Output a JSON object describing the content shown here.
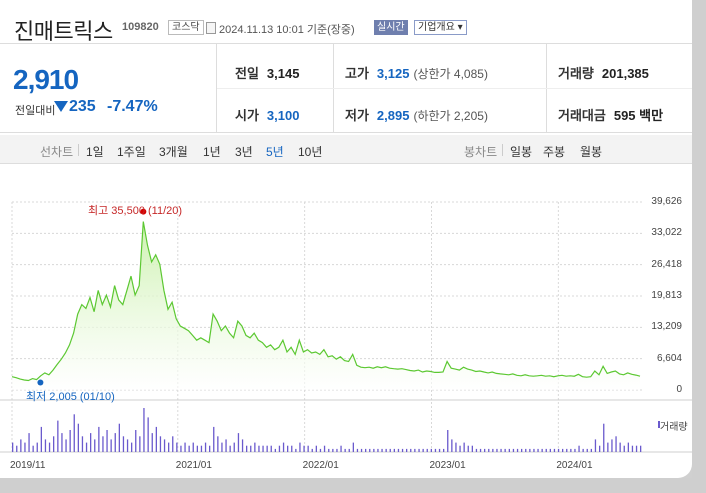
{
  "header": {
    "name": "진매트릭스",
    "code": "109820",
    "market": "코스닥",
    "timestamp": "2024.11.13 10:01",
    "basis": "기준(장중)",
    "live_label": "실시간",
    "company_info_label": "기업개요 ▾"
  },
  "quote": {
    "price": "2,910",
    "change_label": "전일대비",
    "change": "235",
    "change_pct": "-7.47%",
    "direction": "down",
    "color": "#1565c0"
  },
  "stats": {
    "prev_close": {
      "label": "전일",
      "value": "3,145"
    },
    "high": {
      "label": "고가",
      "value": "3,125",
      "note": "(상한가 4,085)"
    },
    "volume": {
      "label": "거래량",
      "value": "201,385"
    },
    "open": {
      "label": "시가",
      "value": "3,100"
    },
    "low": {
      "label": "저가",
      "value": "2,895",
      "note": "(하한가 2,205)"
    },
    "turnover": {
      "label": "거래대금",
      "value": "595 백만"
    }
  },
  "period_bar": {
    "line_label": "선차트",
    "periods": [
      "1일",
      "1주일",
      "3개월",
      "1년",
      "3년",
      "5년",
      "10년"
    ],
    "selected": "5년",
    "candle_label": "봉차트",
    "candles": [
      "일봉",
      "주봉",
      "월봉"
    ]
  },
  "chart_data": {
    "type": "area",
    "title": "",
    "y_ticks": [
      "39,626",
      "33,022",
      "26,418",
      "19,813",
      "13,209",
      "6,604",
      "0"
    ],
    "ylim": [
      0,
      39626
    ],
    "x_ticks": [
      "2019/11",
      "2021/01",
      "2022/01",
      "2023/01",
      "2024/01"
    ],
    "x_start": "2019-11",
    "x_end": "2024-11",
    "series": [
      {
        "values": [
          2800,
          2600,
          2300,
          2100,
          2005,
          2400,
          2200,
          3000,
          3600,
          3200,
          4200,
          5400,
          6500,
          7800,
          9500,
          12000,
          16000,
          18000,
          17200,
          19500,
          16500,
          21000,
          18000,
          20000,
          17500,
          22000,
          19000,
          18000,
          21000,
          24000,
          20000,
          22000,
          35500,
          30500,
          27000,
          28500,
          26500,
          21000,
          17000,
          18500,
          15000,
          13500,
          13000,
          12500,
          11500,
          10500,
          11000,
          10500,
          10000,
          16000,
          14500,
          12500,
          13500,
          12000,
          11000,
          14500,
          13500,
          11500,
          11000,
          12000,
          10500,
          10000,
          9000,
          9500,
          8500,
          9000,
          10500,
          8000,
          9000,
          7500,
          10500,
          8000,
          8500,
          7800,
          8000,
          7500,
          8500,
          7000,
          7200,
          6500,
          7000,
          6200,
          6000,
          7500,
          5200,
          4800,
          4700,
          4800,
          4600,
          4900,
          4700,
          4900,
          4600,
          4500,
          4400,
          4500,
          4300,
          4100,
          4000,
          4200,
          3800,
          4000,
          3900,
          3700,
          3700,
          3800,
          6000,
          4600,
          4400,
          4200,
          4800,
          4400,
          4200,
          3900,
          4000,
          3800,
          3600,
          3800,
          3500,
          3400,
          3300,
          3200,
          3400,
          3100,
          3000,
          3200,
          3000,
          2900,
          3000,
          3100,
          2900,
          3000,
          2800,
          3000,
          3100,
          2900,
          3000,
          2900,
          3300,
          2800,
          2700,
          2800,
          4000,
          3200,
          5000,
          3500,
          3800,
          4000,
          3400,
          3200,
          3600,
          3300,
          3145,
          2910
        ]
      }
    ],
    "annotations": [
      {
        "text": "최고 35,500 (11/20)",
        "type": "max",
        "value": 35500
      },
      {
        "text": "최저 2,005 (01/10)",
        "type": "min",
        "value": 2005
      }
    ],
    "volume_label": "거래량",
    "volume": [
      3,
      2,
      4,
      3,
      6,
      2,
      3,
      8,
      4,
      3,
      5,
      10,
      6,
      4,
      7,
      12,
      9,
      5,
      3,
      6,
      4,
      8,
      5,
      7,
      4,
      6,
      9,
      5,
      4,
      3,
      7,
      5,
      14,
      11,
      6,
      8,
      5,
      4,
      3,
      5,
      3,
      2,
      3,
      2,
      3,
      2,
      2,
      3,
      2,
      8,
      5,
      3,
      4,
      2,
      3,
      6,
      4,
      2,
      2,
      3,
      2,
      2,
      2,
      2,
      1,
      2,
      3,
      2,
      2,
      1,
      3,
      2,
      2,
      1,
      2,
      1,
      2,
      1,
      1,
      1,
      2,
      1,
      1,
      3,
      1,
      1,
      1,
      1,
      1,
      1,
      1,
      1,
      1,
      1,
      1,
      1,
      1,
      1,
      1,
      1,
      1,
      1,
      1,
      1,
      1,
      1,
      7,
      4,
      3,
      2,
      3,
      2,
      2,
      1,
      1,
      1,
      1,
      1,
      1,
      1,
      1,
      1,
      1,
      1,
      1,
      1,
      1,
      1,
      1,
      1,
      1,
      1,
      1,
      1,
      1,
      1,
      1,
      1,
      2,
      1,
      1,
      1,
      4,
      2,
      9,
      3,
      4,
      5,
      3,
      2,
      3,
      2,
      2,
      2
    ],
    "colors": {
      "line": "#5cc832",
      "fill": "#c8f0a8",
      "volume": "#6a5acd",
      "grid": "#d8d8d8"
    }
  }
}
